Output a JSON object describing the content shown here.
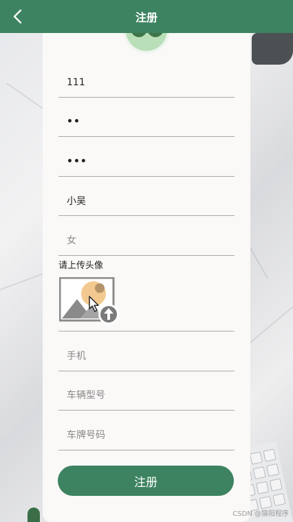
{
  "header": {
    "title": "注册",
    "back_icon": "chevron-left-icon"
  },
  "form": {
    "fields": [
      {
        "name": "username",
        "value": "111",
        "placeholder": ""
      },
      {
        "name": "password",
        "value": "••",
        "placeholder": ""
      },
      {
        "name": "confirm-password",
        "value": "•••",
        "placeholder": ""
      },
      {
        "name": "name",
        "value": "小吴",
        "placeholder": ""
      },
      {
        "name": "gender",
        "value": "",
        "placeholder": "女"
      }
    ],
    "upload_label": "请上传头像",
    "upload_icon": "image-upload-icon",
    "contact_fields": [
      {
        "name": "phone",
        "placeholder": "手机"
      },
      {
        "name": "vehicle-model",
        "placeholder": "车辆型号"
      },
      {
        "name": "plate-number",
        "placeholder": "车牌号码"
      }
    ],
    "submit_label": "注册"
  },
  "watermark": "CSDN @猿阳程序",
  "colors": {
    "brand": "#3d8361",
    "card": "#fbf9f8",
    "divider": "#a9a9a9"
  }
}
